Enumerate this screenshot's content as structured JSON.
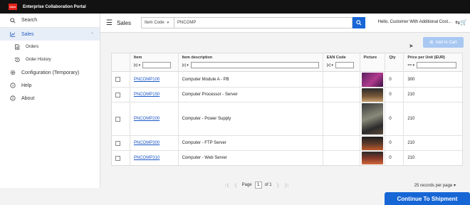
{
  "app": {
    "title": "Enterprise Collaboration Portal",
    "logo": "infor"
  },
  "sidebar": {
    "search_label": "Search",
    "items": [
      {
        "label": "Sales"
      },
      {
        "label": "Orders"
      },
      {
        "label": "Order History"
      },
      {
        "label": "Configuration (Temporary)"
      },
      {
        "label": "Help"
      },
      {
        "label": "About"
      }
    ]
  },
  "header": {
    "title": "Sales",
    "search_field": "Item Code",
    "search_value": "PNCOMP",
    "greeting": "Hello, Customer With Additional Cost..."
  },
  "actions": {
    "add_to_cart": "Add to Cart",
    "continue": "Continue To Shipment"
  },
  "table": {
    "columns": [
      "Item",
      "Item description",
      "EAN Code",
      "Picture",
      "Qty",
      "Price per Unit (EUR)"
    ],
    "filter_ops": {
      "item": "[x] ▾",
      "desc": "[x] ▾",
      "ean": "[x] ▾",
      "price": "== ▾"
    },
    "rows": [
      {
        "item": "PNCOMP100",
        "description": "Computer Module A - PB",
        "ean": "",
        "qty": "0",
        "price": "300"
      },
      {
        "item": "PNCOMP150",
        "description": "Computer Processor - Server",
        "ean": "",
        "qty": "0",
        "price": "210"
      },
      {
        "item": "PNCOMP200",
        "description": "Computer - Power Supply",
        "ean": "",
        "qty": "0",
        "price": "210"
      },
      {
        "item": "PNCOMP300",
        "description": "Computer - FTP Server",
        "ean": "",
        "qty": "0",
        "price": "210"
      },
      {
        "item": "PNCOMP310",
        "description": "Computer - Web Server",
        "ean": "",
        "qty": "0",
        "price": "210"
      }
    ]
  },
  "pager": {
    "page_label": "Page",
    "page": "1",
    "of_label": "of 1",
    "rows_per_page": "25 records per page ▾"
  },
  "colors": {
    "accent": "#1766d6",
    "topbar": "#121212",
    "logo": "#e2231a"
  }
}
